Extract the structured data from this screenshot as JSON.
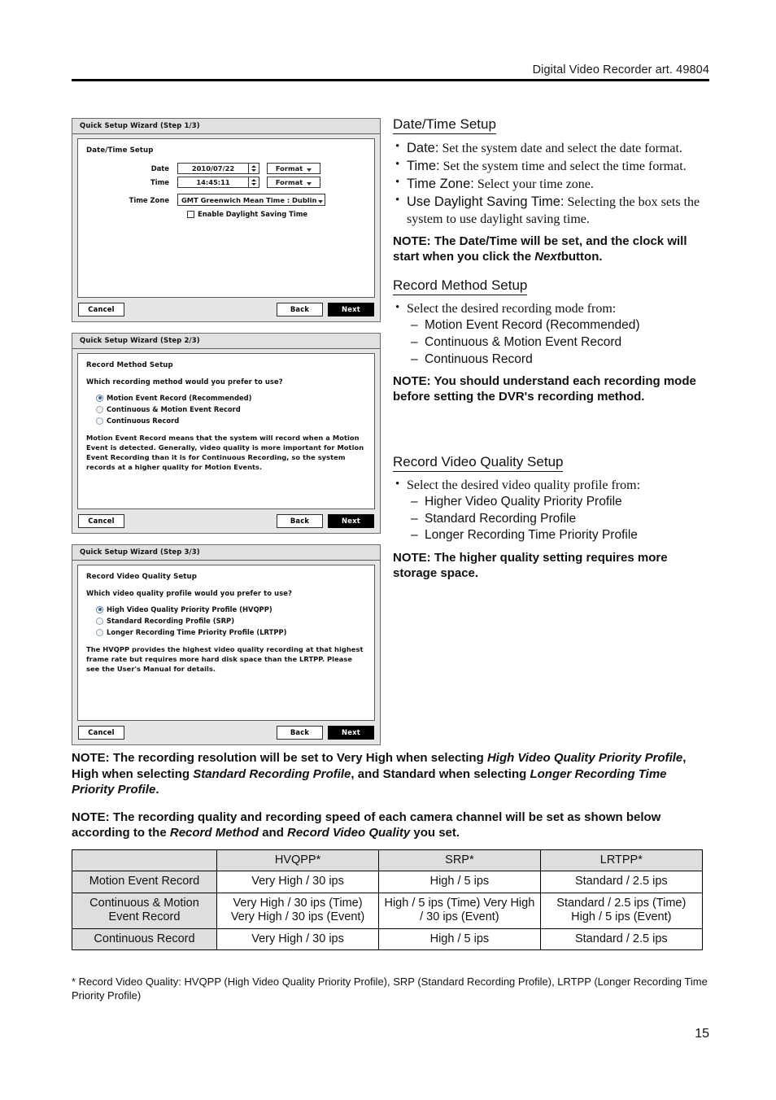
{
  "header": {
    "running_head": "Digital Video Recorder art. 49804"
  },
  "dialogs": [
    {
      "title": "Quick Setup Wizard (Step 1/3)",
      "section": "Date/Time Setup",
      "fields": {
        "date_label": "Date",
        "date_value": "2010/07/22",
        "date_format_button": "Format",
        "time_label": "Time",
        "time_value": "14:45:11",
        "time_format_button": "Format",
        "timezone_label": "Time Zone",
        "timezone_value": "GMT  Greenwich Mean Time : Dublin",
        "dst_checkbox_label": "Enable Daylight Saving Time",
        "dst_checked": false
      },
      "buttons": {
        "cancel": "Cancel",
        "back": "Back",
        "next": "Next"
      }
    },
    {
      "title": "Quick Setup Wizard (Step 2/3)",
      "section": "Record Method Setup",
      "question": "Which recording method would you prefer to use?",
      "options": [
        {
          "label": "Motion Event Record (Recommended)",
          "selected": true
        },
        {
          "label": "Continuous & Motion Event Record",
          "selected": false
        },
        {
          "label": "Continuous Record",
          "selected": false
        }
      ],
      "description": "Motion Event Record means that the system will record when a Motion Event is detected. Generally, video quality is more important for Motion Event Recording than it is for Continuous Recording, so the system records at a higher quality for Motion Events.",
      "buttons": {
        "cancel": "Cancel",
        "back": "Back",
        "next": "Next"
      }
    },
    {
      "title": "Quick Setup Wizard (Step 3/3)",
      "section": "Record Video Quality Setup",
      "question": "Which video quality profile would you prefer to use?",
      "options": [
        {
          "label": "High Video Quality Priority Profile (HVQPP)",
          "selected": true
        },
        {
          "label": "Standard Recording Profile (SRP)",
          "selected": false
        },
        {
          "label": "Longer Recording Time Priority Profile (LRTPP)",
          "selected": false
        }
      ],
      "description": "The HVQPP provides the highest video quality recording at that highest frame rate but requires more hard disk space than the LRTPP. Please see the User's Manual for details.",
      "buttons": {
        "cancel": "Cancel",
        "back": "Back",
        "next": "Next"
      }
    }
  ],
  "sections": [
    {
      "heading": "Date/Time Setup",
      "bullets": [
        {
          "term": "Date:",
          "text": "Set the system date and select the date format."
        },
        {
          "term": "Time:",
          "text": "Set the system time and select the time format."
        },
        {
          "term": "Time Zone:",
          "text": "Select your time zone."
        },
        {
          "term": "Use Daylight Saving Time:",
          "text": "Selecting the box sets the system to use daylight saving time."
        }
      ],
      "note_prefix": "NOTE:",
      "note_part1": "The Date/Time will be set, and the clock will start when you click the",
      "note_em": "Next",
      "note_part2": "button."
    },
    {
      "heading": "Record Method Setup",
      "lead": "Select the desired recording mode from:",
      "sub_items": [
        "Motion Event Record (Recommended)",
        "Continuous & Motion Event Record",
        "Continuous Record"
      ],
      "note": "NOTE:  You should understand each recording mode before setting the DVR's recording method."
    },
    {
      "heading": "Record Video Quality Setup",
      "lead": "Select the desired video quality profile from:",
      "sub_items": [
        "Higher Video Quality Priority Profile",
        "Standard Recording Profile",
        "Longer Recording Time Priority Profile"
      ],
      "note": "NOTE:  The higher quality setting requires more storage space."
    }
  ],
  "bottom_notes": {
    "note1": {
      "prefix": "NOTE:",
      "p1": "The recording resolution will be set to Very High when selecting",
      "em1": "High Video Quality Priority Profile",
      "p2": ", High when selecting",
      "em2": "Standard Recording Profile",
      "p3": ", and Standard when selecting",
      "em3": "Longer Recording Time Priority Profile",
      "p4": "."
    },
    "note2": {
      "prefix": "NOTE:",
      "p1": "The recording quality and recording speed of each camera channel will be set as shown below according to the",
      "em1": "Record Method",
      "p2": "and",
      "em2": "Record Video Quality",
      "p3": "you set."
    }
  },
  "table": {
    "columns": [
      "",
      "HVQPP*",
      "SRP*",
      "LRTPP*"
    ],
    "rows": [
      {
        "label": "Motion Event Record",
        "cells": [
          "Very High / 30 ips",
          "High / 5 ips",
          "Standard / 2.5 ips"
        ]
      },
      {
        "label": "Continuous & Motion Event Record",
        "cells": [
          "Very High / 30 ips (Time) Very High / 30 ips (Event)",
          "High / 5 ips (Time) Very High / 30 ips (Event)",
          "Standard / 2.5 ips (Time) High / 5 ips (Event)"
        ]
      },
      {
        "label": "Continuous Record",
        "cells": [
          "Very High / 30 ips",
          "High / 5 ips",
          "Standard / 2.5 ips"
        ]
      }
    ]
  },
  "footnote": "* Record Video Quality: HVQPP (High Video Quality Priority Profile), SRP (Standard Recording Profile), LRTPP (Longer Recording Time Priority Profile)",
  "page_number": "15"
}
